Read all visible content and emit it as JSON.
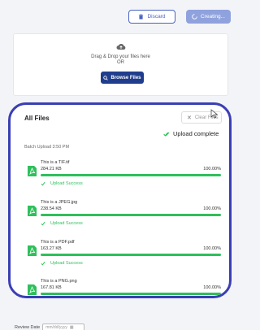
{
  "header": {
    "discard_label": "Discard",
    "creating_label": "Creating..."
  },
  "dropzone": {
    "line1": "Drag & Drop your files here",
    "line2": "OR",
    "browse_label": "Browse Files"
  },
  "files": {
    "title": "All Files",
    "clear_label": "Clear Files",
    "complete_label": "Upload complete",
    "batch_label": "Batch Upload 3:50 PM",
    "items": [
      {
        "name": "This is a TIF.tif",
        "size": "284.21 KB",
        "percent": "100.00%",
        "progress": 1.0,
        "status": "Upload Success"
      },
      {
        "name": "This is a JPEG.jpg",
        "size": "238.54 KB",
        "percent": "100.00%",
        "progress": 1.0,
        "status": "Upload Success"
      },
      {
        "name": "This is a PDF.pdf",
        "size": "163.27 KB",
        "percent": "100.00%",
        "progress": 1.0,
        "status": "Upload Success"
      },
      {
        "name": "This is a PNG.png",
        "size": "167.81 KB",
        "percent": "100.00%",
        "progress": 1.0,
        "status": ""
      }
    ]
  },
  "review": {
    "label": "Review Date",
    "placeholder": "mm/dd/yyyy"
  },
  "colors": {
    "accent": "#3a3fb5",
    "primary_button": "#1f3d8c",
    "success": "#2fbf5b"
  }
}
